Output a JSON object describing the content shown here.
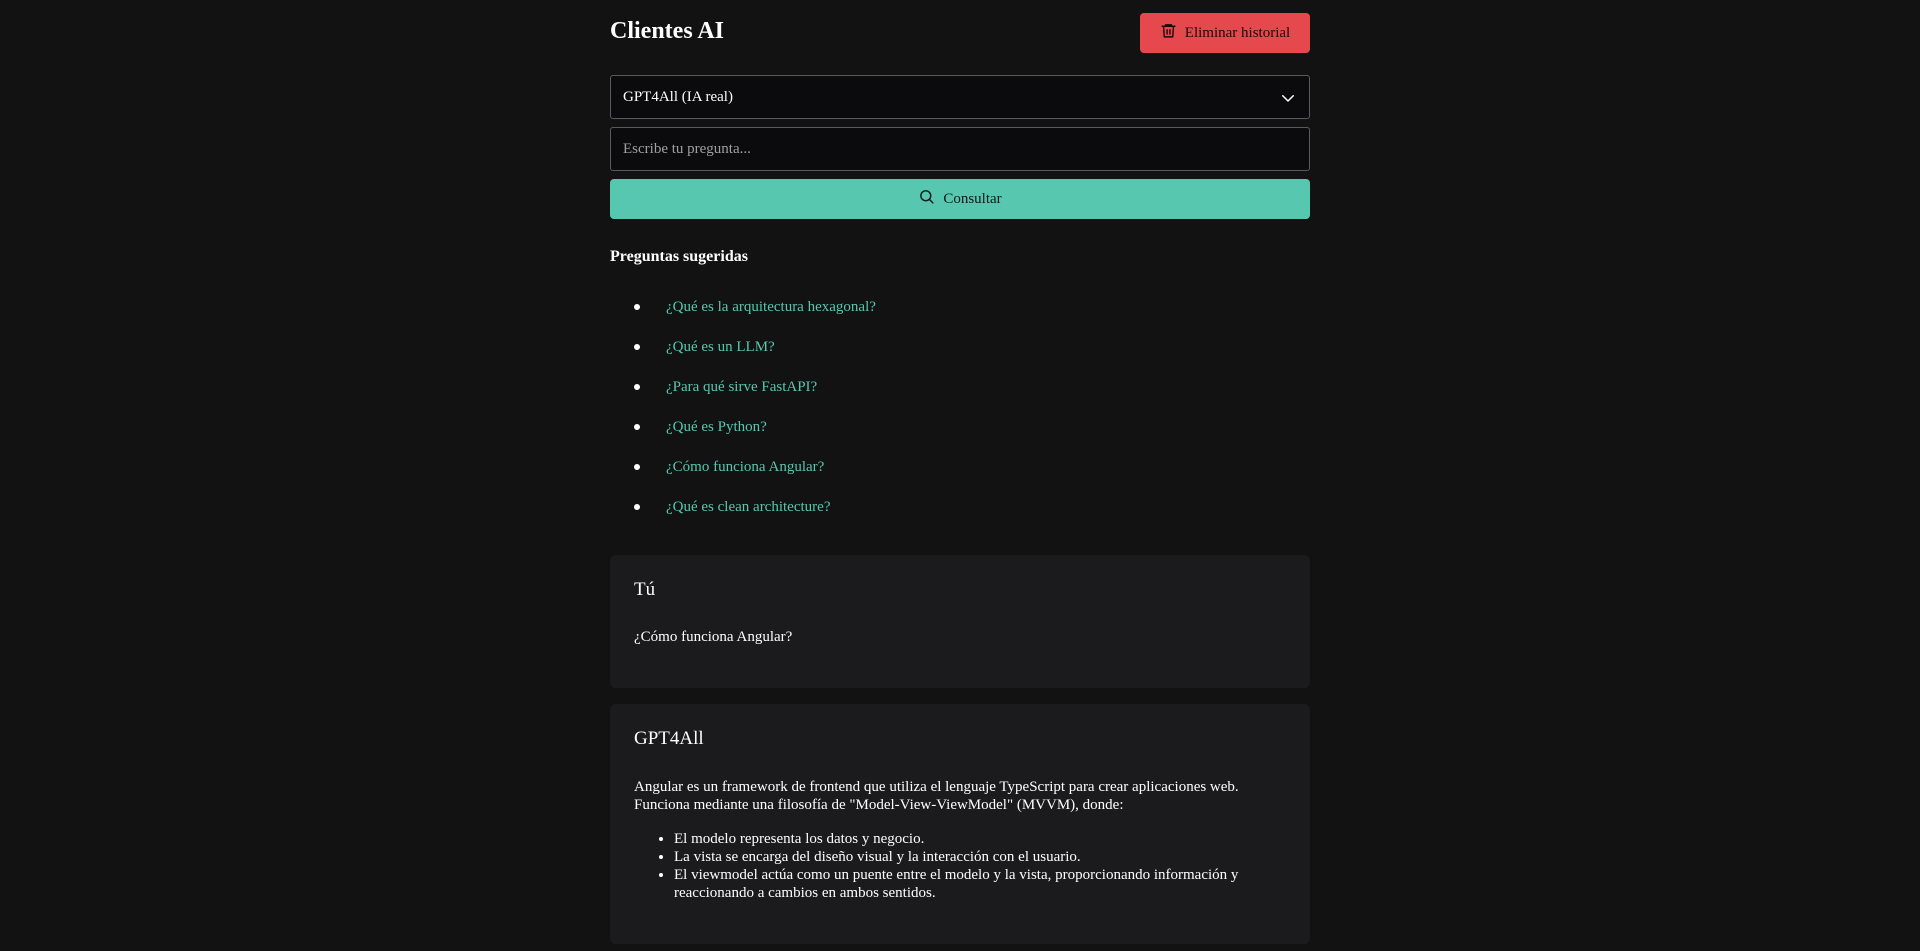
{
  "header": {
    "title": "Clientes AI",
    "delete_label": "Eliminar historial"
  },
  "form": {
    "model_selected": "GPT4All (IA real)",
    "question_placeholder": "Escribe tu pregunta...",
    "question_value": "",
    "submit_label": "Consultar"
  },
  "suggestions": {
    "title": "Preguntas sugeridas",
    "items": [
      "¿Qué es la arquitectura hexagonal?",
      "¿Qué es un LLM?",
      "¿Para qué sirve FastAPI?",
      "¿Qué es Python?",
      "¿Cómo funciona Angular?",
      "¿Qué es clean architecture?"
    ]
  },
  "conversation": {
    "user": {
      "author": "Tú",
      "message": "¿Cómo funciona Angular?"
    },
    "bot": {
      "author": "GPT4All",
      "intro": "Angular es un framework de frontend que utiliza el lenguaje TypeScript para crear aplicaciones web. Funciona mediante una filosofía de \"Model-View-ViewModel\" (MVVM), donde:",
      "points": [
        "El modelo representa los datos y negocio.",
        "La vista se encarga del diseño visual y la interacción con el usuario.",
        "El viewmodel actúa como un puente entre el modelo y la vista, proporcionando información y reaccionando a cambios en ambos sentidos."
      ]
    }
  },
  "colors": {
    "background": "#121212",
    "accent": "#57c7b0",
    "danger": "#e5484d",
    "card": "#1b1b1e"
  },
  "icons": {
    "delete": "trash-icon",
    "select": "chevron-down-icon",
    "submit": "search-icon"
  }
}
